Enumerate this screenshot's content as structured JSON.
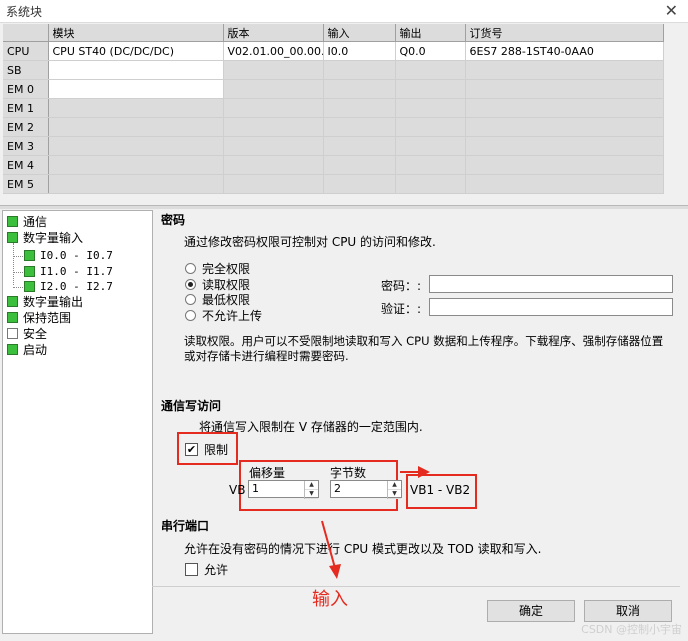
{
  "window": {
    "title": "系统块"
  },
  "table": {
    "headers": [
      "",
      "模块",
      "版本",
      "输入",
      "输出",
      "订货号"
    ],
    "rows": [
      [
        "CPU",
        "CPU ST40 (DC/DC/DC)",
        "V02.01.00_00.00...",
        "I0.0",
        "Q0.0",
        "6ES7 288-1ST40-0AA0"
      ],
      [
        "SB",
        "",
        "",
        "",
        "",
        ""
      ],
      [
        "EM 0",
        "",
        "",
        "",
        "",
        ""
      ],
      [
        "EM 1",
        "",
        "",
        "",
        "",
        ""
      ],
      [
        "EM 2",
        "",
        "",
        "",
        "",
        ""
      ],
      [
        "EM 3",
        "",
        "",
        "",
        "",
        ""
      ],
      [
        "EM 4",
        "",
        "",
        "",
        "",
        ""
      ],
      [
        "EM 5",
        "",
        "",
        "",
        "",
        ""
      ]
    ]
  },
  "tree": {
    "comm": "通信",
    "dig_in": "数字量输入",
    "in0": "I0.0 - I0.7",
    "in1": "I1.0 - I1.7",
    "in2": "I2.0 - I2.7",
    "dig_out": "数字量输出",
    "retentive": "保持范围",
    "security": "安全",
    "startup": "启动"
  },
  "password": {
    "heading": "密码",
    "desc": "通过修改密码权限可控制对 CPU 的访问和修改.",
    "options": [
      "完全权限",
      "读取权限",
      "最低权限",
      "不允许上传"
    ],
    "selected_index": 1,
    "pwd_label": "密码：:",
    "verify_label": "验证：:",
    "info_line1": "读取权限。用户可以不受限制地读取和写入 CPU 数据和上传程序。下载程序、强制存储器位置",
    "info_line2": "或对存储卡进行编程时需要密码."
  },
  "comm_write": {
    "heading": "通信写访问",
    "desc": "将通信写入限制在 V 存储器的一定范围内.",
    "limit_label": "限制",
    "limit_checked": true,
    "offset_label": "偏移量",
    "bytes_label": "字节数",
    "vb_prefix": "VB",
    "offset_value": "1",
    "bytes_value": "2",
    "range_text": "VB1 - VB2"
  },
  "serial": {
    "heading": "串行端口",
    "desc": "允许在没有密码的情况下进行 CPU 模式更改以及 TOD 读取和写入.",
    "allow_label": "允许",
    "allow_checked": false
  },
  "annotation": {
    "text": "输入",
    "color": "#e52a1f"
  },
  "buttons": {
    "ok": "确定",
    "cancel": "取消"
  },
  "watermark": "CSDN @控制小宇宙"
}
